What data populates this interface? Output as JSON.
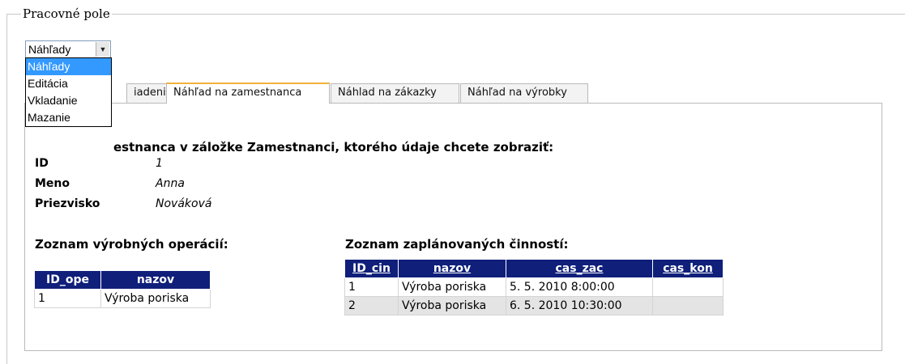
{
  "fieldset": {
    "legend": "Pracovné pole"
  },
  "mode_select": {
    "value": "Náhľady",
    "options": [
      "Náhľady",
      "Editácia",
      "Vkladanie",
      "Mazanie"
    ]
  },
  "tabs": [
    {
      "label": "iadenia"
    },
    {
      "label": "Náhľad na zamestnanca"
    },
    {
      "label": "Náhlad na zákazky"
    },
    {
      "label": "Náhľad na výrobky"
    }
  ],
  "instruction": "estnanca v záložke Zamestnanci, ktorého údaje chcete zobraziť:",
  "employee": {
    "id_label": "ID",
    "id_value": "1",
    "name_label": "Meno",
    "name_value": "Anna",
    "surname_label": "Priezvisko",
    "surname_value": "Nováková"
  },
  "operations": {
    "title": "Zoznam výrobných operácií:",
    "headers": [
      "ID_ope",
      "nazov"
    ],
    "rows": [
      [
        "1",
        "Výroba poriska"
      ]
    ]
  },
  "activities": {
    "title": "Zoznam zaplánovaných činností:",
    "headers": [
      "ID_cin",
      "nazov",
      "cas_zac",
      "cas_kon"
    ],
    "rows": [
      [
        "1",
        "Výroba poriska",
        "5. 5. 2010 8:00:00",
        ""
      ],
      [
        "2",
        "Výroba poriska",
        "6. 5. 2010 10:30:00",
        ""
      ]
    ]
  }
}
